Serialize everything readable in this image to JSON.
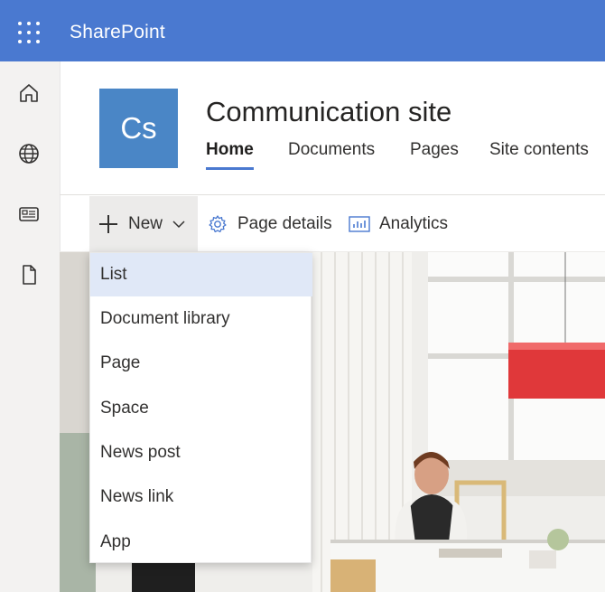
{
  "suite": {
    "brand": "SharePoint",
    "waffle_icon": "app-launcher-icon",
    "bar_color": "#4a79d0"
  },
  "rail": {
    "items": [
      {
        "icon": "home-icon"
      },
      {
        "icon": "globe-icon"
      },
      {
        "icon": "news-icon"
      },
      {
        "icon": "document-icon"
      }
    ]
  },
  "site": {
    "logo_text": "Cs",
    "logo_color": "#4a86c6",
    "title": "Communication site",
    "nav": [
      {
        "label": "Home",
        "active": true
      },
      {
        "label": "Documents",
        "active": false
      },
      {
        "label": "Pages",
        "active": false
      },
      {
        "label": "Site contents",
        "active": false
      }
    ]
  },
  "commandbar": {
    "new_label": "New",
    "page_details_label": "Page details",
    "analytics_label": "Analytics"
  },
  "new_menu": {
    "items": [
      {
        "label": "List",
        "highlighted": true
      },
      {
        "label": "Document library"
      },
      {
        "label": "Page"
      },
      {
        "label": "Space"
      },
      {
        "label": "News post"
      },
      {
        "label": "News link"
      },
      {
        "label": "App"
      }
    ],
    "highlight_color": "#e0e8f7"
  }
}
